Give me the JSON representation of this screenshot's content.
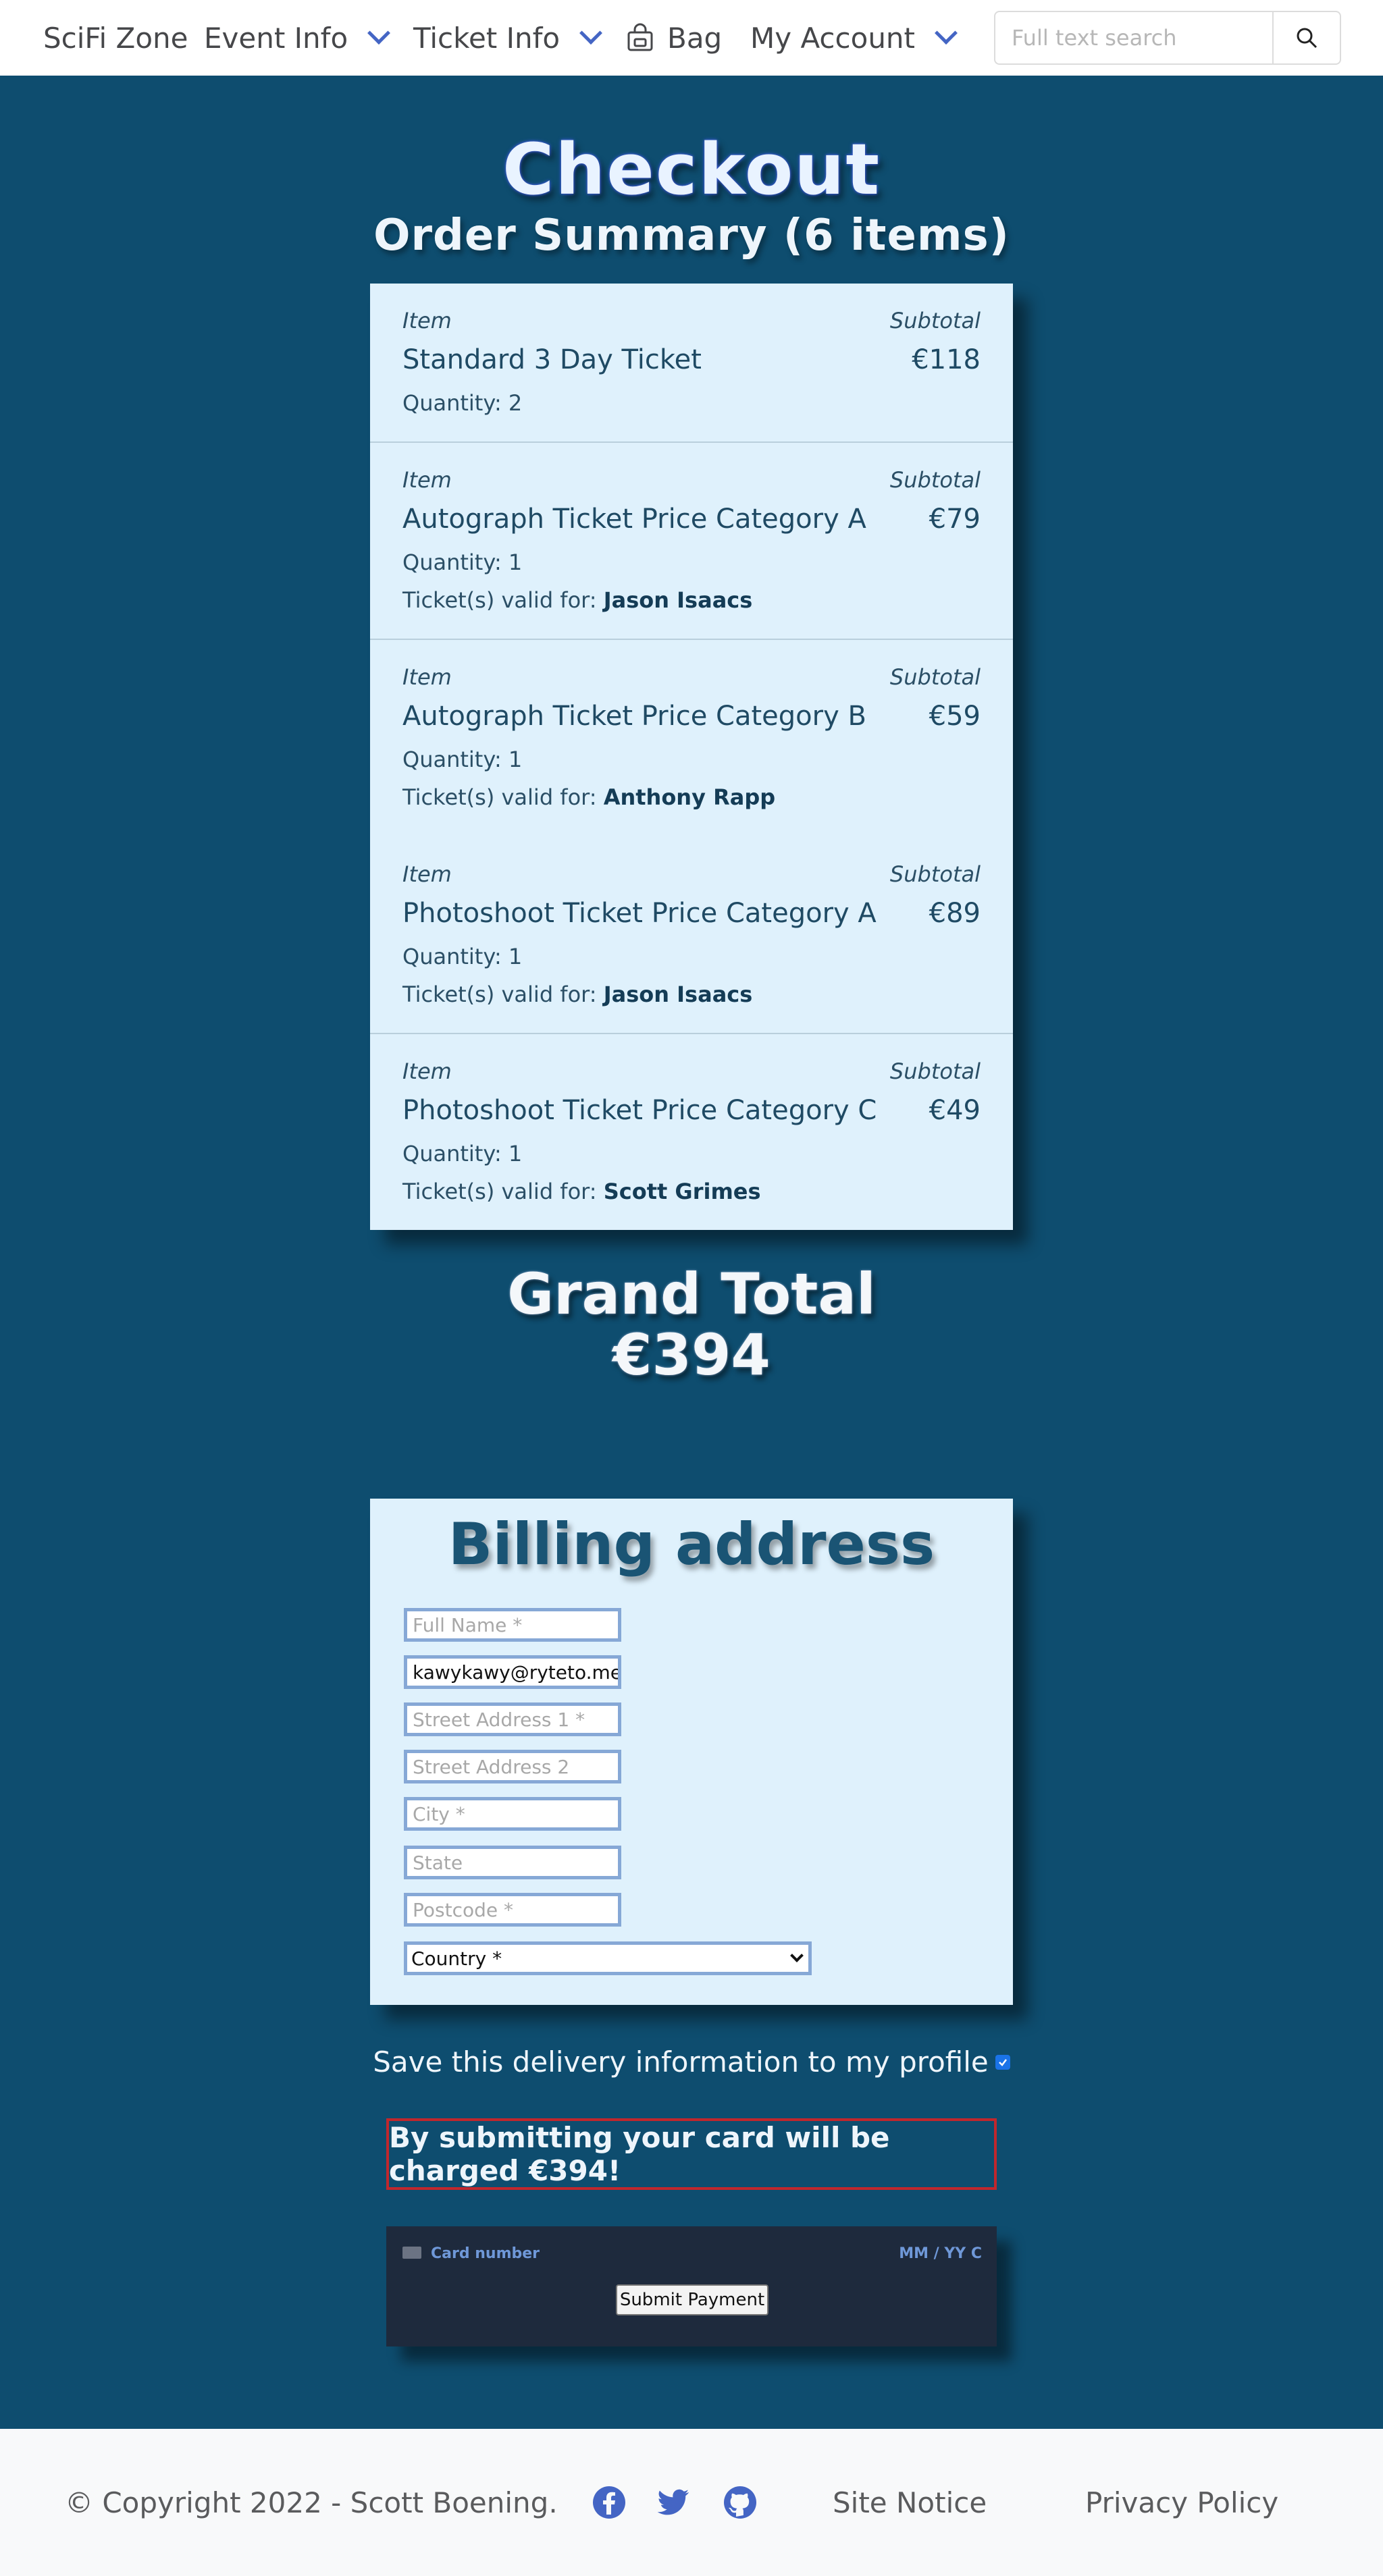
{
  "nav": {
    "brand": "SciFi Zone",
    "event_info": "Event Info",
    "ticket_info": "Ticket Info",
    "bag": "Bag",
    "my_account": "My Account",
    "search_placeholder": "Full text search"
  },
  "checkout": {
    "title": "Checkout",
    "summary_title": "Order Summary (6 items)",
    "item_label": "Item",
    "subtotal_label": "Subtotal",
    "valid_prefix": "Ticket(s) valid for:",
    "items": [
      {
        "name": "Standard 3 Day Ticket",
        "price": "€118",
        "quantity": "Quantity: 2",
        "valid_for": ""
      },
      {
        "name": "Autograph Ticket Price Category A",
        "price": "€79",
        "quantity": "Quantity: 1",
        "valid_for": "Jason Isaacs"
      },
      {
        "name": "Autograph Ticket Price Category B",
        "price": "€59",
        "quantity": "Quantity: 1",
        "valid_for": "Anthony Rapp"
      },
      {
        "name": "Photoshoot Ticket Price Category A",
        "price": "€89",
        "quantity": "Quantity: 1",
        "valid_for": "Jason Isaacs"
      },
      {
        "name": "Photoshoot Ticket Price Category C",
        "price": "€49",
        "quantity": "Quantity: 1",
        "valid_for": "Scott Grimes"
      }
    ],
    "grand_total_label": "Grand Total",
    "grand_total_value": "€394"
  },
  "billing": {
    "title": "Billing address",
    "full_name_placeholder": "Full Name *",
    "email_value": "kawykawy@ryteto.me",
    "street1_placeholder": "Street Address 1 *",
    "street2_placeholder": "Street Address 2",
    "city_placeholder": "City *",
    "state_placeholder": "State",
    "postcode_placeholder": "Postcode *",
    "country_selected": "Country *"
  },
  "save_info_label": "Save this delivery information to my profile",
  "charge_notice": "By submitting your card will be charged €394!",
  "payment": {
    "card_number_placeholder": "Card number",
    "expiry_placeholder": "MM / YY  C",
    "submit_label": "Submit Payment"
  },
  "footer": {
    "copyright": "© Copyright 2022 - Scott Boening.",
    "site_notice": "Site Notice",
    "privacy_policy": "Privacy Policy"
  },
  "colors": {
    "page_bg": "#0e4d6f",
    "card_bg": "#dff1fc",
    "accent": "#4465c4",
    "alert_border": "#c1272d"
  }
}
